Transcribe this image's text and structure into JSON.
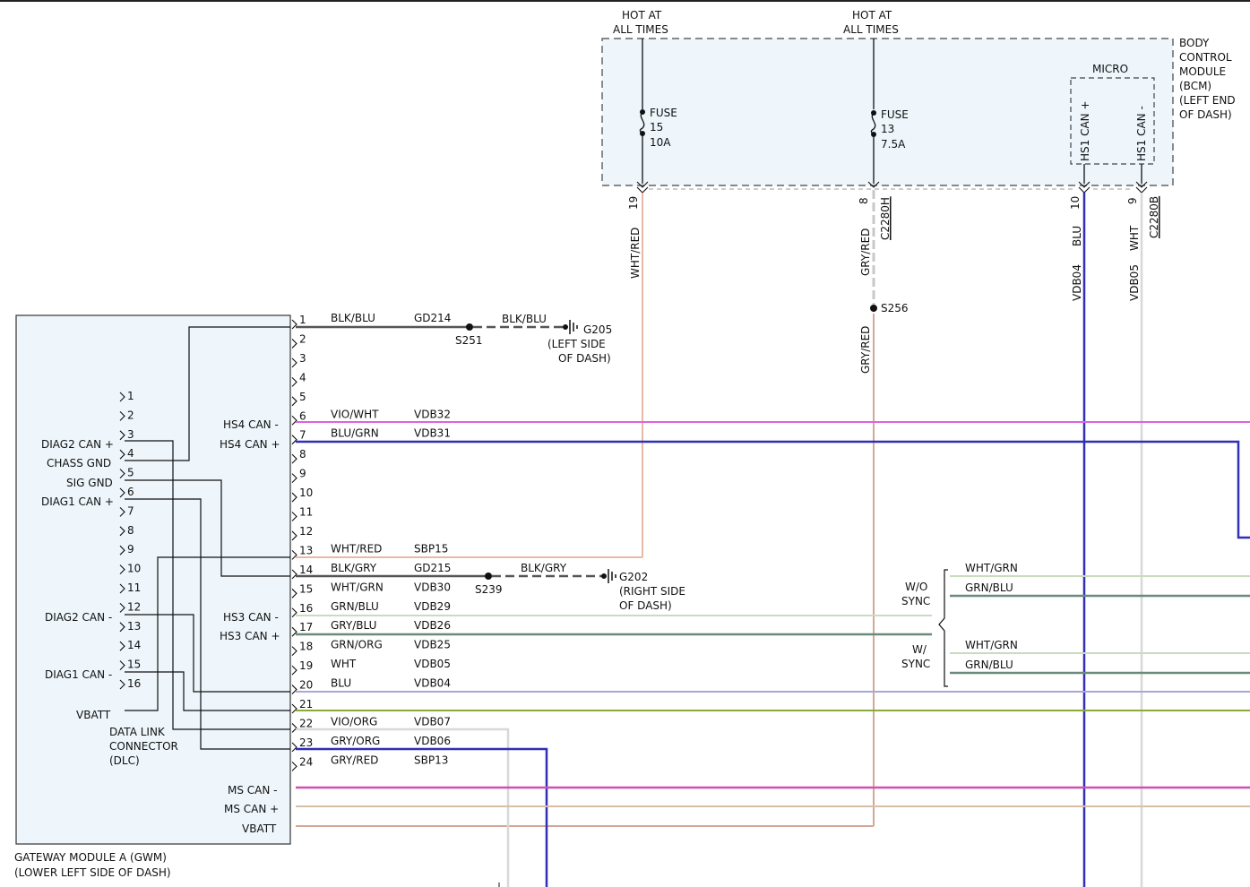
{
  "top_labels": {
    "hot1_line1": "HOT AT",
    "hot1_line2": "ALL TIMES",
    "hot2_line1": "HOT AT",
    "hot2_line2": "ALL TIMES"
  },
  "bcm": {
    "lines": [
      "BODY",
      "CONTROL",
      "MODULE",
      "(BCM)",
      "(LEFT END",
      "OF DASH)"
    ],
    "micro": "MICRO",
    "hs1_can_plus": "HS1 CAN +",
    "hs1_can_minus": "HS1 CAN -",
    "fuse15": [
      "FUSE",
      "15",
      "10A"
    ],
    "fuse13": [
      "FUSE",
      "13",
      "7.5A"
    ],
    "pins": {
      "p19": "19",
      "p8": "8",
      "p10": "10",
      "p9": "9"
    },
    "connector_h": "C2280H",
    "connector_b": "C2280B"
  },
  "vertical_wires": {
    "wht_red": "WHT/RED",
    "gry_red_upper": "GRY/RED",
    "gry_red_lower": "GRY/RED",
    "blu": "BLU",
    "vdb04": "VDB04",
    "wht": "WHT",
    "vdb05": "VDB05"
  },
  "splices": {
    "s256": "S256",
    "s251": "S251",
    "s239": "S239"
  },
  "grounds": {
    "g205": [
      "G205",
      "(LEFT SIDE",
      "OF DASH)"
    ],
    "g202": [
      "G202",
      "(RIGHT SIDE",
      "OF DASH)"
    ],
    "blk_blu_dash": "BLK/BLU",
    "blk_gry_dash": "BLK/GRY"
  },
  "gwm": {
    "title1": "GATEWAY MODULE A (GWM)",
    "title2": "(LOWER LEFT SIDE OF DASH)",
    "hs4_can_minus": "HS4 CAN -",
    "hs4_can_plus": "HS4 CAN +",
    "hs3_can_minus": "HS3 CAN -",
    "hs3_can_plus": "HS3 CAN +",
    "ms_can_minus": "MS CAN -",
    "ms_can_plus": "MS CAN +",
    "vbatt": "VBATT"
  },
  "gwm_pins": [
    {
      "pin": "1",
      "color": "BLK/BLU",
      "circuit": "GD214"
    },
    {
      "pin": "2",
      "color": "",
      "circuit": ""
    },
    {
      "pin": "3",
      "color": "",
      "circuit": ""
    },
    {
      "pin": "4",
      "color": "",
      "circuit": ""
    },
    {
      "pin": "5",
      "color": "",
      "circuit": ""
    },
    {
      "pin": "6",
      "color": "VIO/WHT",
      "circuit": "VDB32"
    },
    {
      "pin": "7",
      "color": "BLU/GRN",
      "circuit": "VDB31"
    },
    {
      "pin": "8",
      "color": "",
      "circuit": ""
    },
    {
      "pin": "9",
      "color": "",
      "circuit": ""
    },
    {
      "pin": "10",
      "color": "",
      "circuit": ""
    },
    {
      "pin": "11",
      "color": "",
      "circuit": ""
    },
    {
      "pin": "12",
      "color": "",
      "circuit": ""
    },
    {
      "pin": "13",
      "color": "WHT/RED",
      "circuit": "SBP15"
    },
    {
      "pin": "14",
      "color": "BLK/GRY",
      "circuit": "GD215"
    },
    {
      "pin": "15",
      "color": "WHT/GRN",
      "circuit": "VDB30"
    },
    {
      "pin": "16",
      "color": "GRN/BLU",
      "circuit": "VDB29"
    },
    {
      "pin": "17",
      "color": "GRY/BLU",
      "circuit": "VDB26"
    },
    {
      "pin": "18",
      "color": "GRN/ORG",
      "circuit": "VDB25"
    },
    {
      "pin": "19",
      "color": "WHT",
      "circuit": "VDB05"
    },
    {
      "pin": "20",
      "color": "BLU",
      "circuit": "VDB04"
    },
    {
      "pin": "21",
      "color": "",
      "circuit": ""
    },
    {
      "pin": "22",
      "color": "VIO/ORG",
      "circuit": "VDB07"
    },
    {
      "pin": "23",
      "color": "GRY/ORG",
      "circuit": "VDB06"
    },
    {
      "pin": "24",
      "color": "GRY/RED",
      "circuit": "SBP13"
    }
  ],
  "dlc": {
    "title": [
      "DATA LINK",
      "CONNECTOR",
      "(DLC)"
    ],
    "pins": [
      "1",
      "2",
      "3",
      "4",
      "5",
      "6",
      "7",
      "8",
      "9",
      "10",
      "11",
      "12",
      "13",
      "14",
      "15",
      "16"
    ],
    "diag2_can_plus": "DIAG2 CAN +",
    "chass_gnd": "CHASS GND",
    "sig_gnd": "SIG GND",
    "diag1_can_plus": "DIAG1 CAN +",
    "diag2_can_minus": "DIAG2 CAN -",
    "diag1_can_minus": "DIAG1 CAN -",
    "vbatt": "VBATT"
  },
  "sync": {
    "wo_sync": [
      "W/O",
      "SYNC"
    ],
    "w_sync": [
      "W/",
      "SYNC"
    ],
    "wo_wht_grn": "WHT/GRN",
    "wo_grn_blu": "GRN/BLU",
    "w_wht_grn": "WHT/GRN",
    "w_grn_blu": "GRN/BLU"
  },
  "colors": {
    "wht_red": "#e8b8a8",
    "gry_red": "#d4a898",
    "blue": "#2f2fb8",
    "white_wire": "#d8d8d8",
    "magenta": "#e060e0",
    "wht_grn": "#c8dcc0",
    "grn_blu": "#6a8a7a",
    "gry_blu": "#a8a8d8",
    "grn_org": "#8aaa3a",
    "vio_org": "#d050b0",
    "gry_org": "#d8c0a8",
    "box_fill": "#eef6fb",
    "black": "#111111",
    "dark": "#444444"
  }
}
